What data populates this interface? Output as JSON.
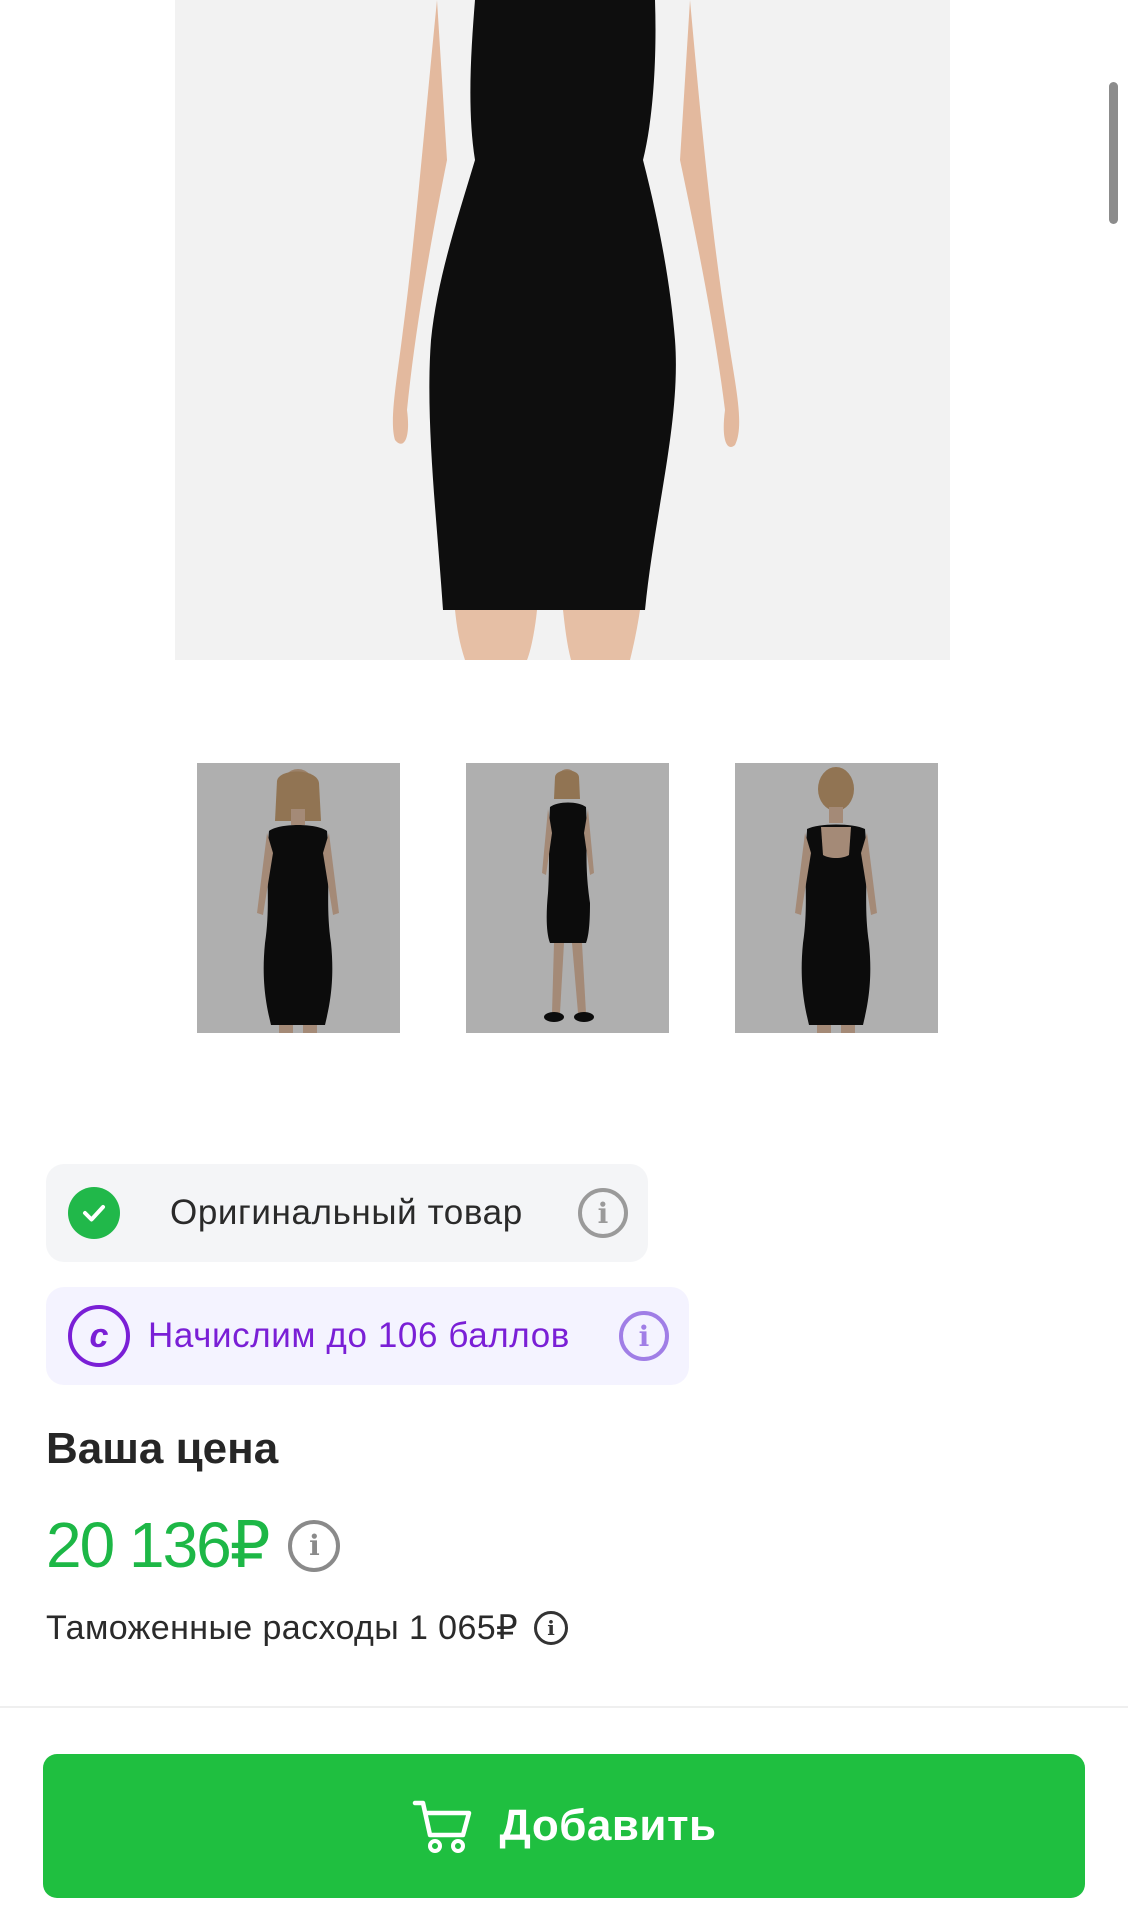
{
  "badges": {
    "original": {
      "label": "Оригинальный товар",
      "icon": "check-circle-icon"
    },
    "points": {
      "label": "Начислим до 106 баллов",
      "icon_letter": "с"
    }
  },
  "price": {
    "title": "Ваша цена",
    "value": "20 136₽",
    "customs": "Таможенные расходы 1 065₽"
  },
  "actions": {
    "add_label": "Добавить"
  },
  "colors": {
    "accent_green": "#1fbf40",
    "price_green": "#1db746",
    "points_purple": "#7a1fd6"
  },
  "gallery": {
    "thumbnail_count": 3
  }
}
